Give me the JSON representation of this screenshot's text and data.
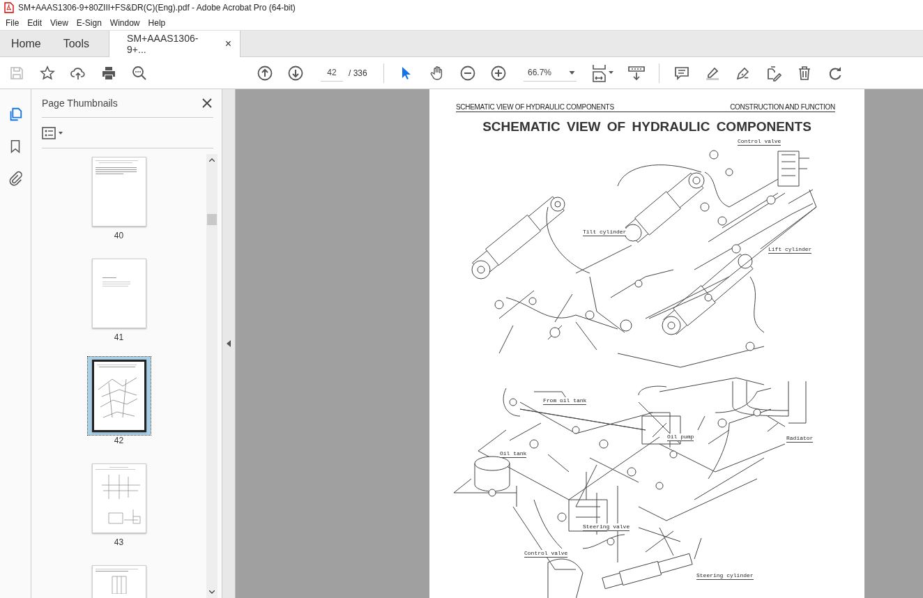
{
  "window": {
    "title": "SM+AAAS1306-9+80ZIII+FS&DR(C)(Eng).pdf - Adobe Acrobat Pro (64-bit)"
  },
  "menu": [
    "File",
    "Edit",
    "View",
    "E-Sign",
    "Window",
    "Help"
  ],
  "tabs": [
    {
      "label": "Home",
      "selected": false,
      "kind": "nav"
    },
    {
      "label": "Tools",
      "selected": false,
      "kind": "nav"
    },
    {
      "label": "SM+AAAS1306-9+...",
      "selected": true,
      "kind": "document",
      "close": "×"
    }
  ],
  "file_tools": [
    {
      "kind": "save",
      "disabled": true
    },
    {
      "kind": "star",
      "disabled": false
    },
    {
      "kind": "upload",
      "disabled": false
    },
    {
      "kind": "print",
      "disabled": false
    },
    {
      "kind": "search",
      "disabled": false
    }
  ],
  "page_nav": {
    "page": "42",
    "total": "/ 336"
  },
  "view_tools": [
    {
      "kind": "select",
      "selected": true
    },
    {
      "kind": "hand",
      "selected": false
    },
    {
      "kind": "zoomout",
      "selected": false
    },
    {
      "kind": "zoomin",
      "selected": false
    }
  ],
  "zoom": "66.7%",
  "edit_tools": [
    {
      "kind": "comment"
    },
    {
      "kind": "highlight"
    },
    {
      "kind": "sign"
    },
    {
      "kind": "edit"
    },
    {
      "kind": "delete"
    },
    {
      "kind": "rotate"
    }
  ],
  "rail": [
    {
      "kind": "pages",
      "selected": true
    },
    {
      "kind": "bookmarks",
      "selected": false
    },
    {
      "kind": "attachments",
      "selected": false
    }
  ],
  "sidebar": {
    "title": "Page Thumbnails",
    "thumbnails": [
      {
        "label": "40",
        "selected": false,
        "kind": "text"
      },
      {
        "label": "41",
        "selected": false,
        "kind": "list"
      },
      {
        "label": "42",
        "selected": true,
        "kind": "diagram"
      },
      {
        "label": "43",
        "selected": false,
        "kind": "schematic"
      },
      {
        "selected": false,
        "kind": "table"
      }
    ]
  },
  "document": {
    "header_left": "SCHEMATIC VIEW OF HYDRAULIC COMPONENTS",
    "header_right": "CONSTRUCTION AND FUNCTION",
    "title": "SCHEMATIC VIEW OF HYDRAULIC COMPONENTS",
    "callouts": [
      {
        "label": "Control valve"
      },
      {
        "label": "Tilt cylinder"
      },
      {
        "label": "Lift cylinder"
      },
      {
        "label": "From oil tank"
      },
      {
        "label": "Oil pump"
      },
      {
        "label": "Radiator"
      },
      {
        "label": "Oil tank"
      },
      {
        "label": "Steering valve"
      },
      {
        "label": "Control valve"
      },
      {
        "label": "Steering cylinder"
      }
    ]
  }
}
